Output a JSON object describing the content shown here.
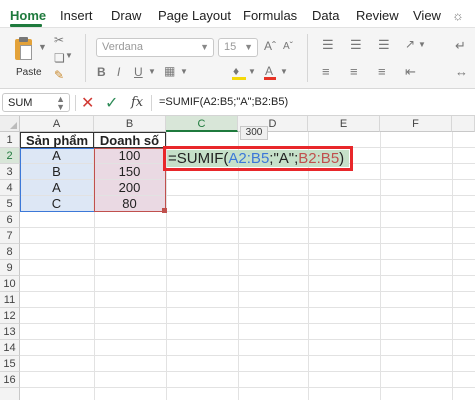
{
  "ribbon": {
    "tabs": [
      "Home",
      "Insert",
      "Draw",
      "Page Layout",
      "Formulas",
      "Data",
      "Review",
      "View"
    ],
    "paste_label": "Paste",
    "font_name": "Verdana",
    "font_size": "15",
    "accent_color": "#1f7a3d"
  },
  "formula_bar": {
    "name_box": "SUM",
    "fx_label": "fx",
    "formula": "=SUMIF(A2:B5;\"A\";B2:B5)"
  },
  "grid": {
    "columns": [
      "A",
      "B",
      "C",
      "D",
      "E",
      "F"
    ],
    "rows": [
      "1",
      "2",
      "3",
      "4",
      "5",
      "6",
      "7",
      "8",
      "9",
      "10",
      "11",
      "12",
      "13",
      "14",
      "15",
      "16"
    ],
    "headers": [
      "Sản phẩm",
      "Doanh số"
    ],
    "data": [
      [
        "A",
        "100"
      ],
      [
        "B",
        "150"
      ],
      [
        "A",
        "200"
      ],
      [
        "C",
        "80"
      ]
    ],
    "tooltip_value": "300",
    "active_cell": {
      "prefix": "=SUMIF(",
      "ref1": "A2:B5",
      "sep1": ";\"A\";",
      "ref2": "B2:B5",
      "suffix": ")"
    },
    "ref1_color": "#3c78d8",
    "ref2_color": "#c0504d",
    "highlight_color": "#e8272a"
  }
}
